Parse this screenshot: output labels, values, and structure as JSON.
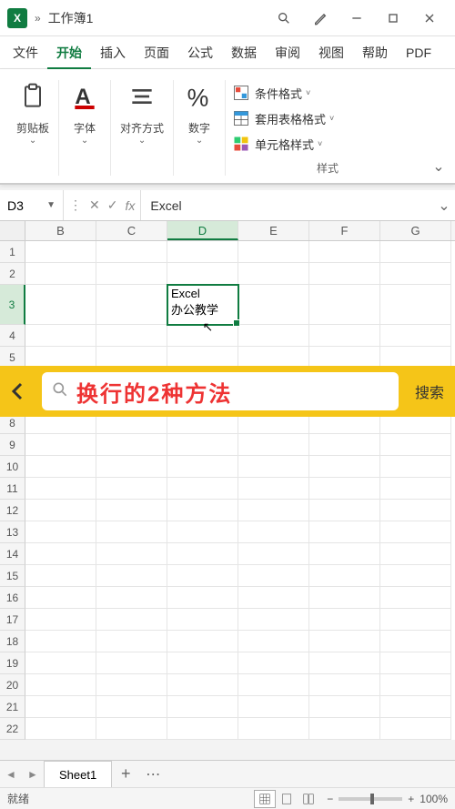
{
  "titlebar": {
    "doc_title": "工作簿1"
  },
  "menu": {
    "items": [
      "文件",
      "开始",
      "插入",
      "页面",
      "公式",
      "数据",
      "审阅",
      "视图",
      "帮助",
      "PDF"
    ],
    "active_index": 1
  },
  "ribbon": {
    "clipboard": "剪贴板",
    "font": "字体",
    "align": "对齐方式",
    "number": "数字",
    "cond_format": "条件格式",
    "table_format": "套用表格格式",
    "cell_styles": "单元格样式",
    "styles_label": "样式"
  },
  "formula_bar": {
    "name_box": "D3",
    "formula": "Excel"
  },
  "grid": {
    "columns": [
      "B",
      "C",
      "D",
      "E",
      "F",
      "G"
    ],
    "selected_col": "D",
    "row_count": 22,
    "selected_row": 3,
    "cell_d3_line1": "Excel",
    "cell_d3_line2": "办公教学"
  },
  "overlay": {
    "text": "换行的2种方法",
    "search_btn": "搜索"
  },
  "sheets": {
    "tab1": "Sheet1"
  },
  "status": {
    "ready": "就绪",
    "zoom": "100%"
  }
}
